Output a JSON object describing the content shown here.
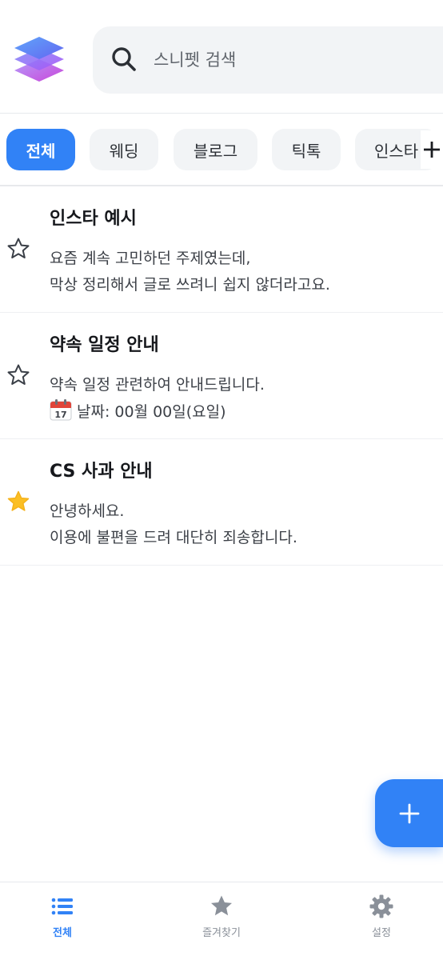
{
  "search": {
    "placeholder": "스니펫 검색"
  },
  "tabs": [
    {
      "label": "전체",
      "active": true
    },
    {
      "label": "웨딩",
      "active": false
    },
    {
      "label": "블로그",
      "active": false
    },
    {
      "label": "틱톡",
      "active": false
    },
    {
      "label": "인스타",
      "active": false
    }
  ],
  "snippets": [
    {
      "title": "인스타 예시",
      "lines": [
        "요즘 계속 고민하던 주제였는데,",
        "막상 정리해서 글로 쓰려니 쉽지 않더라고요."
      ],
      "favorite": false
    },
    {
      "title": "약속 일정 안내",
      "lines": [
        "약속 일정 관련하여 안내드립니다.",
        "날짜: 00월 00일(요일)"
      ],
      "favorite": false,
      "line2_icon": "calendar-icon"
    },
    {
      "title": "CS 사과 안내",
      "lines": [
        "안녕하세요.",
        "이용에 불편을 드려 대단히 죄송합니다."
      ],
      "favorite": true
    }
  ],
  "bottom_nav": [
    {
      "label": "전체",
      "icon": "list-icon",
      "active": true
    },
    {
      "label": "즐겨찾기",
      "icon": "star-icon",
      "active": false
    },
    {
      "label": "설정",
      "icon": "gear-icon",
      "active": false
    }
  ],
  "colors": {
    "accent": "#3182f6",
    "favorite": "#fbbf24",
    "chip_bg": "#f2f4f6",
    "inactive_icon": "#8a9099"
  }
}
